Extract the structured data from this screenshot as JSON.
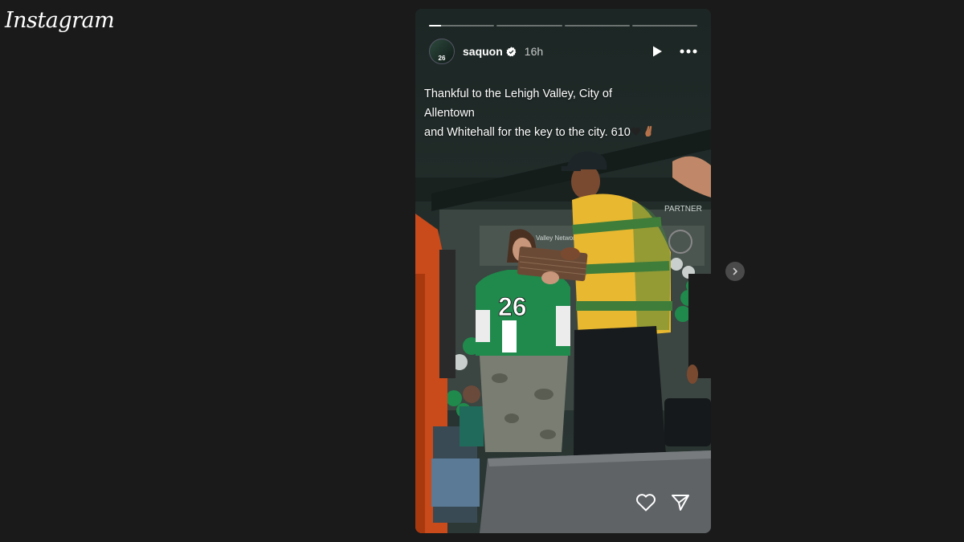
{
  "app": {
    "logo_text": "Instagram"
  },
  "story": {
    "progress": [
      1,
      0,
      0,
      0
    ],
    "progress_current_fill": 0.18,
    "user": {
      "username": "saquon",
      "verified": true,
      "time_ago": "16h",
      "avatar_text": "26"
    },
    "caption_line1": "Thankful to the Lehigh Valley, City of Allentown",
    "caption_line2": "and Whitehall for the key to the city. 610",
    "scene_text": {
      "jersey_number": "26",
      "banner": "PARTNER",
      "banner2": "Valley Network"
    }
  },
  "icons": {
    "play": "play-icon",
    "more": "more-options-icon",
    "like": "heart-icon",
    "share": "send-icon",
    "next": "chevron-right-icon",
    "verified": "verified-badge-icon"
  },
  "colors": {
    "page_bg": "#1a1a1a",
    "verified_blue": "#ffffff",
    "jersey_green": "#1f8a4c",
    "sweater_yellow": "#e8b830",
    "sweater_green": "#3f7d3a"
  }
}
